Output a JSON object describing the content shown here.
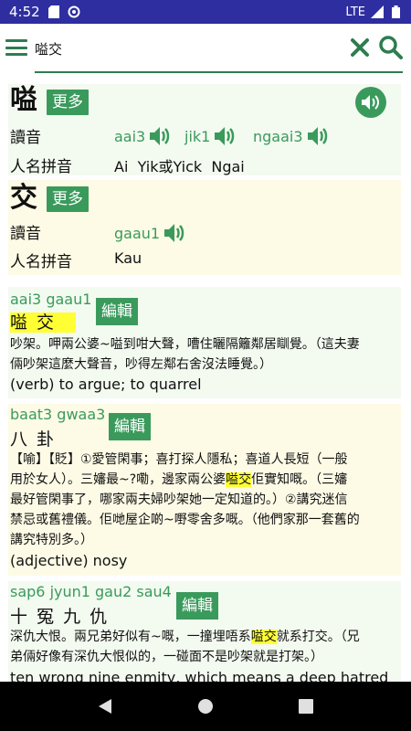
{
  "status": {
    "time": "4:52",
    "network": "LTE"
  },
  "search": {
    "query": "嗌交"
  },
  "chars": [
    {
      "char": "嗌",
      "more_label": "更多",
      "reading_label": "讀音",
      "readings": [
        "aai3",
        "jik1",
        "ngaai3"
      ],
      "name_label": "人名拼音",
      "name_values": "Ai  Yik或Yick  Ngai"
    },
    {
      "char": "交",
      "more_label": "更多",
      "reading_label": "讀音",
      "readings": [
        "gaau1"
      ],
      "name_label": "人名拼音",
      "name_values": "Kau"
    }
  ],
  "entries": [
    {
      "jyutping": "aai3 gaau1",
      "headword": "嗌 交",
      "edit_label": "編輯",
      "def_lines": [
        "吵架。呷兩公婆~嗌到咁大聲，嘈住曬隔籬鄰居瞓覺。（這夫妻",
        "倆吵架這麼大聲音，吵得左鄰右舍沒法睡覺。）"
      ],
      "english": "(verb) to argue; to quarrel"
    },
    {
      "jyutping": "baat3 gwaa3",
      "headword": "八  卦",
      "edit_label": "編輯",
      "def_lines": [
        "【喻】【貶】①愛管閑事；喜打探人隱私；喜道人長短（一般",
        "用於女人）。三嬸最~?嘞，邊家兩公婆",
        "嗌交",
        "佢實知嘅。（三嬸",
        "最好管閑事了，哪家兩夫婦吵架她一定知道的。）②講究迷信",
        "禁忌或舊禮儀。佢哋屋企啲~嘢零舍多嘅。（他們家那一套舊的",
        "講究特別多。）"
      ],
      "english": "(adjective) nosy"
    },
    {
      "jyutping": "sap6 jyun1 gau2 sau4",
      "headword": "十  冤  九  仇",
      "edit_label": "編輯",
      "def_lines": [
        "深仇大恨。兩兄弟好似有~嘅，一撞埋唔系",
        "嗌交",
        "就系打交。（兄",
        "弟倆好像有深仇大恨似的，一碰面不是吵架就是打架。）"
      ],
      "english": "ten wrong nine enmity, which means a deep hatred"
    }
  ]
}
